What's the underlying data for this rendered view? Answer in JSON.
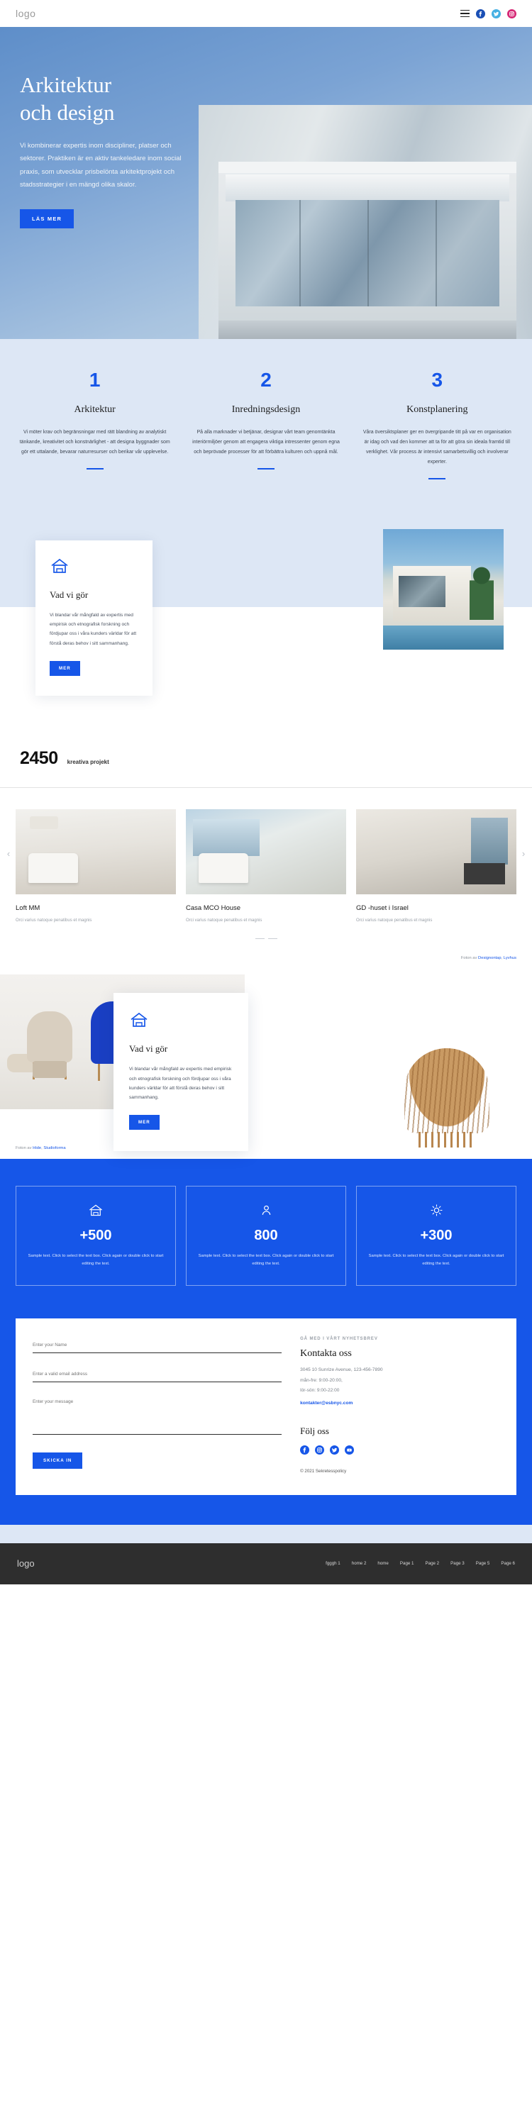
{
  "header": {
    "logo": "logo",
    "menu_icon": "hamburger-menu-icon",
    "social": [
      {
        "name": "facebook-icon",
        "label": "Facebook"
      },
      {
        "name": "twitter-icon",
        "label": "Twitter"
      },
      {
        "name": "instagram-icon",
        "label": "Instagram"
      }
    ]
  },
  "hero": {
    "title_line1": "Arkitektur",
    "title_line2": "och design",
    "paragraph": "Vi kombinerar expertis inom discipliner, platser och sektorer. Praktiken är en aktiv tankeledare inom social praxis, som utvecklar prisbelönta arkitektprojekt och stadsstrategier i en mängd olika skalor.",
    "cta": "LÄS MER"
  },
  "features": [
    {
      "number": "1",
      "title": "Arkitektur",
      "text": "Vi möter krav och begränsningar med rätt blandning av analytiskt tänkande, kreativitet och konstnärlighet - att designa byggnader som gör ett uttalande, bevarar naturresurser och berikar vår upplevelse."
    },
    {
      "number": "2",
      "title": "Inredningsdesign",
      "text": "På alla marknader vi betjänar, designar vårt team genomtänkta interiörmiljöer genom att engagera viktiga intressenter genom egna och beprövade processer för att förbättra kulturen och uppnå mål."
    },
    {
      "number": "3",
      "title": "Konstplanering",
      "text": "Våra översiktsplaner ger en övergripande titt på var en organisation är idag och vad den kommer att ta för att göra sin ideala framtid till verklighet. Vår process är intensivt samarbetsvillig och involverar experter."
    }
  ],
  "about": {
    "icon": "house-outline-icon",
    "title": "Vad vi gör",
    "text": "Vi blandar vår mångfald av expertis med empirisk och etnografisk forskning och fördjupar oss i våra kunders världar för att förstå deras behov i sitt sammanhang.",
    "cta": "MER"
  },
  "counter": {
    "number": "2450",
    "label": "kreativa projekt"
  },
  "portfolio": {
    "prev_icon": "chevron-left-icon",
    "next_icon": "chevron-right-icon",
    "items": [
      {
        "title": "Loft MM",
        "subtitle": "Orci varius natoque penatibus et magnis"
      },
      {
        "title": "Casa MCO House",
        "subtitle": "Orci varius natoque penatibus et magnis"
      },
      {
        "title": "GD -huset i Israel",
        "subtitle": "Orci varius natoque penatibus et magnis"
      }
    ],
    "credit_prefix": "Foton av ",
    "credit_link1": "Designontap",
    "credit_sep": ", ",
    "credit_link2": "Lyvhus"
  },
  "furniture": {
    "icon": "house-outline-icon",
    "title": "Vad vi gör",
    "text": "Vi blandar vår mångfald av expertis med empirisk och etnografisk forskning och fördjupar oss i våra kunders världar för att förstå deras behov i sitt sammanhang.",
    "cta": "MER",
    "credit_prefix": "Foton av ",
    "credit_link1": "Hide",
    "credit_sep": ", ",
    "credit_link2": "Studioforma"
  },
  "stats": [
    {
      "icon": "house-outline-icon",
      "number": "+500",
      "text": "Sample text. Click to select the text box. Click again or double click to start editing the text."
    },
    {
      "icon": "person-outline-icon",
      "number": "800",
      "text": "Sample text. Click to select the text box. Click again or double click to start editing the text."
    },
    {
      "icon": "sun-outline-icon",
      "number": "+300",
      "text": "Sample text. Click to select the text box. Click again or double click to start editing the text."
    }
  ],
  "contact": {
    "name_placeholder": "Enter your Name",
    "email_placeholder": "Enter a valid email address",
    "message_placeholder": "Enter your message",
    "submit": "SKICKA IN",
    "eyebrow": "GÅ MED I VÅRT NYHETSBREV",
    "title": "Kontakta oss",
    "address": "3045 10 Sunrize Avenue, 123-456-7890",
    "hours_week": "mån-fre: 9:00-20:00,",
    "hours_weekend": "lör-sön: 9:00-22:00",
    "email": "kontakter@esbnyc.com",
    "follow_title": "Följ oss",
    "follow": [
      {
        "name": "facebook-icon"
      },
      {
        "name": "instagram-icon"
      },
      {
        "name": "twitter-icon"
      },
      {
        "name": "youtube-icon"
      }
    ],
    "copyright": "© 2021 Sekretesspolicy"
  },
  "footer": {
    "logo": "logo",
    "nav": [
      "fgggh 1",
      "home 2",
      "home",
      "Page 1",
      "Page 2",
      "Page 3",
      "Page 5",
      "Page 6"
    ]
  },
  "colors": {
    "accent": "#1656e8",
    "feature_bg": "#dde7f5",
    "footer_bg": "#2e2e2e"
  }
}
